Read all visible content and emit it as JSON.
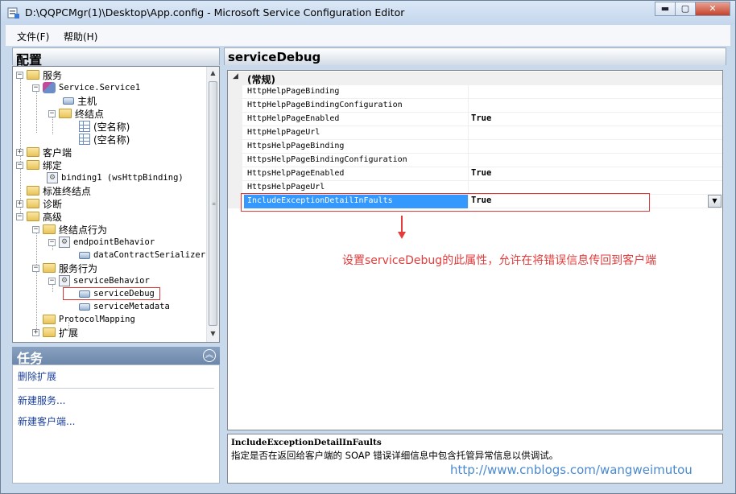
{
  "window": {
    "title": "D:\\QQPCMgr(1)\\Desktop\\App.config - Microsoft Service Configuration Editor",
    "minimize": "▬",
    "maximize": "▢",
    "close": "✕"
  },
  "menu": [
    {
      "label": "文件(F)"
    },
    {
      "label": "帮助(H)"
    }
  ],
  "left_pane": {
    "title": "配置",
    "tree": [
      {
        "label": "服务",
        "icon": "folder-icon",
        "expander": "−"
      },
      {
        "label": "Service.Service1",
        "icon": "service-icon",
        "expander": "−"
      },
      {
        "label": "主机",
        "icon": "leaf-icon"
      },
      {
        "label": "终结点",
        "icon": "folder-icon",
        "expander": "−"
      },
      {
        "label": "(空名称)",
        "icon": "endpoint-icon"
      },
      {
        "label": "(空名称)",
        "icon": "endpoint-icon"
      },
      {
        "label": "客户端",
        "icon": "folder-icon",
        "expander": "+"
      },
      {
        "label": "绑定",
        "icon": "folder-icon",
        "expander": "−"
      },
      {
        "label": "binding1 (wsHttpBinding)",
        "icon": "binding-icon"
      },
      {
        "label": "标准终结点",
        "icon": "folder-icon"
      },
      {
        "label": "诊断",
        "icon": "folder-icon",
        "expander": "+"
      },
      {
        "label": "高级",
        "icon": "folder-icon",
        "expander": "−"
      },
      {
        "label": "终结点行为",
        "icon": "folder-icon",
        "expander": "−"
      },
      {
        "label": "endpointBehavior",
        "icon": "behavior-icon",
        "expander": "−"
      },
      {
        "label": "dataContractSerializer",
        "icon": "leaf-icon"
      },
      {
        "label": "服务行为",
        "icon": "folder-icon",
        "expander": "−"
      },
      {
        "label": "serviceBehavior",
        "icon": "behavior-icon",
        "expander": "−"
      },
      {
        "label": "serviceDebug",
        "icon": "leaf-icon"
      },
      {
        "label": "serviceMetadata",
        "icon": "leaf-icon"
      },
      {
        "label": "ProtocolMapping",
        "icon": "folder-icon"
      },
      {
        "label": "扩展",
        "icon": "folder-icon",
        "expander": "+"
      }
    ],
    "scroll_up": "▲",
    "scroll_down": "▼",
    "scroll_grip": "≡"
  },
  "tasks": {
    "title": "任务",
    "collapse_glyph": "︽",
    "items": [
      "删除扩展",
      "新建服务...",
      "新建客户端..."
    ]
  },
  "right_pane": {
    "title": "serviceDebug",
    "category": {
      "label": "(常规)",
      "toggle": "◢"
    },
    "properties": [
      {
        "name": "HttpHelpPageBinding",
        "value": ""
      },
      {
        "name": "HttpHelpPageBindingConfiguration",
        "value": ""
      },
      {
        "name": "HttpHelpPageEnabled",
        "value": "True"
      },
      {
        "name": "HttpHelpPageUrl",
        "value": ""
      },
      {
        "name": "HttpsHelpPageBinding",
        "value": ""
      },
      {
        "name": "HttpsHelpPageBindingConfiguration",
        "value": ""
      },
      {
        "name": "HttpsHelpPageEnabled",
        "value": "True"
      },
      {
        "name": "HttpsHelpPageUrl",
        "value": ""
      },
      {
        "name": "IncludeExceptionDetailInFaults",
        "value": "True"
      }
    ],
    "dropdown_glyph": "▼",
    "annotation": "设置serviceDebug的此属性，允许在将错误信息传回到客户端",
    "description": {
      "title": "IncludeExceptionDetailInFaults",
      "text": "指定是否在返回给客户端的 SOAP 错误详细信息中包含托管异常信息以供调试。"
    },
    "watermark": "http://www.cnblogs.com/wangweimutou"
  },
  "colors": {
    "selection": "#3399ff",
    "annotation_red": "#e23c3c",
    "link_blue": "#1a3f9c"
  }
}
